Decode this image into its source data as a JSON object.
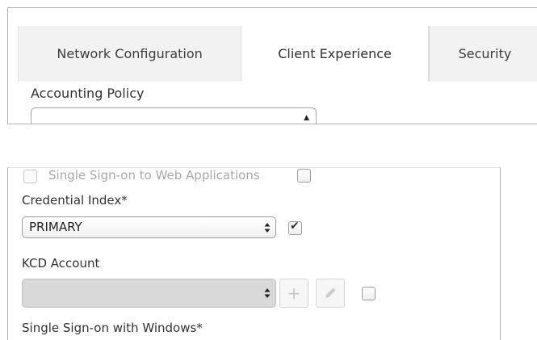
{
  "tabs": [
    {
      "label": "Network Configuration",
      "active": false
    },
    {
      "label": "Client Experience",
      "active": true
    },
    {
      "label": "Security",
      "active": false
    }
  ],
  "accounting": {
    "label": "Accounting Policy",
    "value": ""
  },
  "sso_web": {
    "label": "Single Sign-on to Web Applications",
    "checked": false,
    "enabled": false
  },
  "credential_index": {
    "label": "Credential Index*",
    "value": "PRIMARY",
    "override_checked": true
  },
  "kcd_account": {
    "label": "KCD Account",
    "value": "",
    "add_icon": "plus-icon",
    "edit_icon": "pencil-icon",
    "override_checked": false
  },
  "sso_windows": {
    "label": "Single Sign-on with Windows*"
  },
  "icons": {
    "select_arrow_up": "▲",
    "updown": "updown-icon",
    "check": "✔",
    "plus": "+",
    "pencil": "pencil-icon"
  }
}
